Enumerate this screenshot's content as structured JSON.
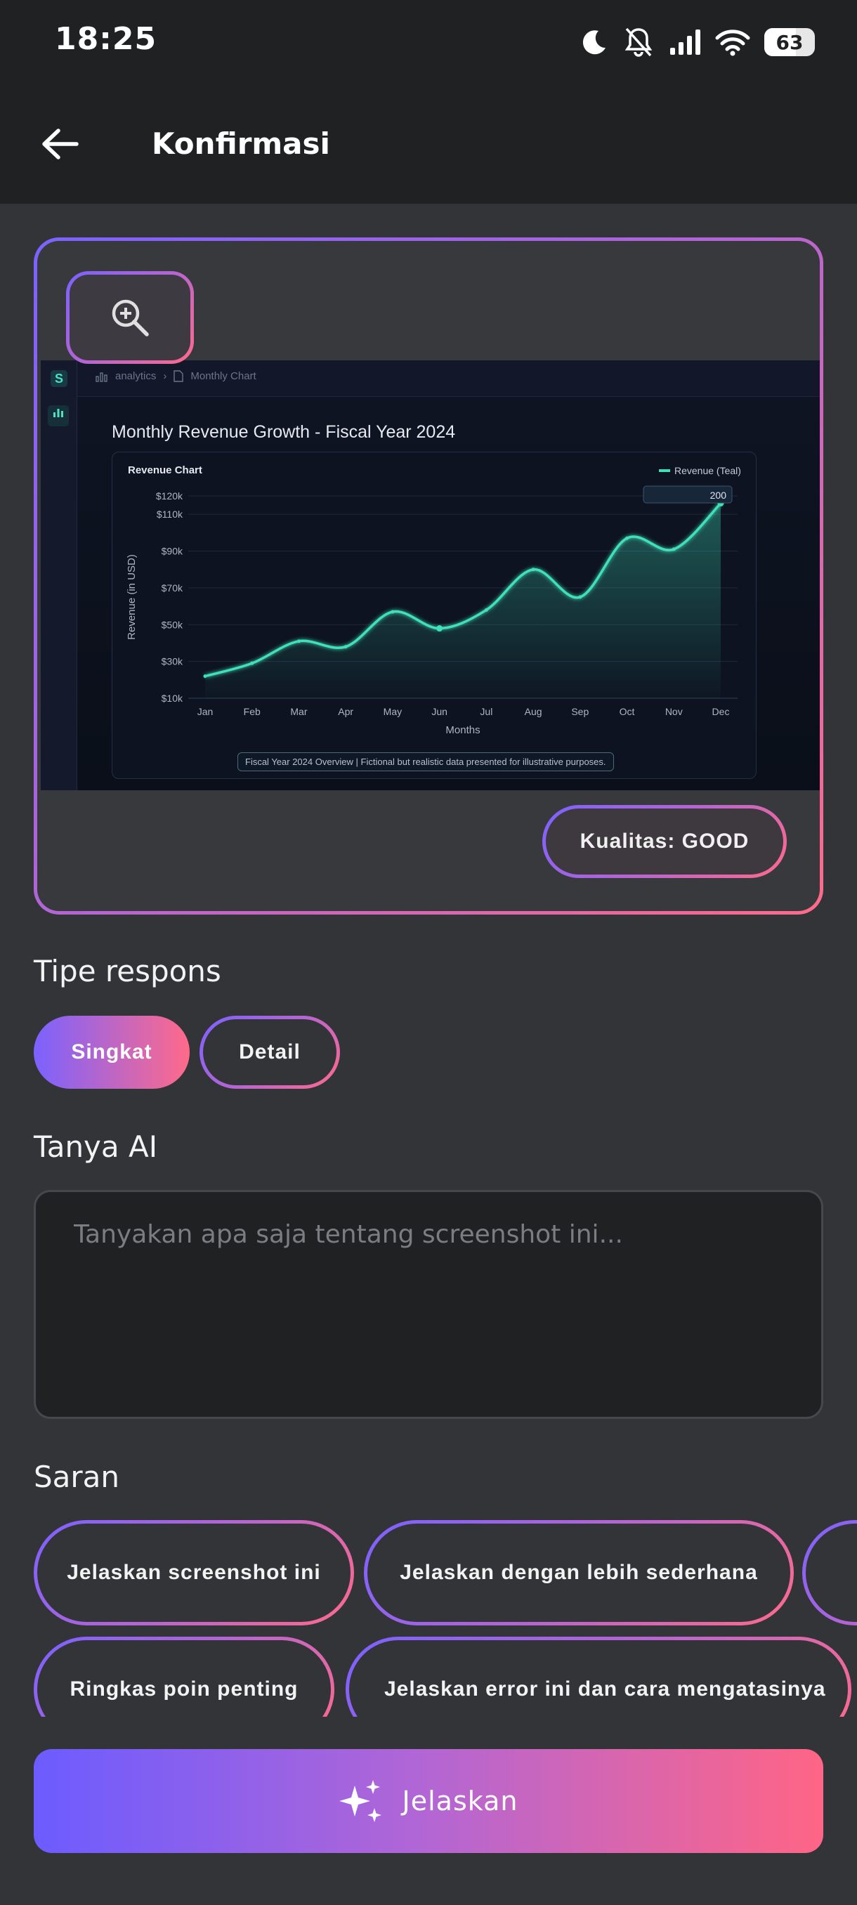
{
  "status_bar": {
    "time": "18:25",
    "battery_level": "63",
    "battery_fraction": 0.63,
    "icons": [
      "moon-icon",
      "bell-off-icon",
      "signal-icon",
      "wifi-icon",
      "battery-icon"
    ]
  },
  "app_bar": {
    "title": "Konfirmasi",
    "back_icon": "arrow-left-icon"
  },
  "preview": {
    "zoom_icon": "zoom-in-icon",
    "quality_label": "Kualitas: GOOD",
    "screenshot": {
      "breadcrumb_1": "analytics",
      "breadcrumb_sep": "›",
      "breadcrumb_2": "Monthly Chart",
      "logo_letter": "S",
      "side_icon": "bar-chart-icon",
      "footer_note": "Fiscal Year 2024 Overview | Fictional but realistic data presented for illustrative purposes."
    }
  },
  "chart_data": {
    "type": "area",
    "title": "Monthly Revenue Growth - Fiscal Year 2024",
    "panel_title": "Revenue Chart",
    "xlabel": "Months",
    "ylabel": "Revenue (in USD)",
    "x": [
      "Jan",
      "Feb",
      "Mar",
      "Apr",
      "May",
      "Jun",
      "Jul",
      "Aug",
      "Sep",
      "Oct",
      "Nov",
      "Dec"
    ],
    "y_ticks": [
      "$10k",
      "$30k",
      "$50k",
      "$70k",
      "$90k",
      "$110k",
      "$120k"
    ],
    "y_tick_values": [
      10,
      30,
      50,
      70,
      90,
      110,
      120
    ],
    "ylim": [
      10,
      120
    ],
    "series": [
      {
        "name": "Revenue (Teal)",
        "values": [
          22,
          29,
          41,
          38,
          57,
          48,
          58,
          80,
          65,
          97,
          91,
          116
        ],
        "color": "#3fe0b8"
      }
    ],
    "tooltip": "200",
    "grid": true,
    "legend_position": "top-right"
  },
  "response_type": {
    "title": "Tipe respons",
    "options": [
      "Singkat",
      "Detail"
    ],
    "selected": "Singkat"
  },
  "ask_ai": {
    "title": "Tanya AI",
    "placeholder": "Tanyakan apa saja tentang screenshot ini..."
  },
  "suggestions": {
    "title": "Saran",
    "items": [
      "Jelaskan screenshot ini",
      "Jelaskan dengan lebih sederhana",
      "Ringkas poin penting",
      "Jelaskan error ini dan cara mengatasinya"
    ]
  },
  "action": {
    "label": "Jelaskan",
    "icon": "sparkles-icon"
  },
  "colors": {
    "background": "#323437",
    "bar": "#1f2123",
    "gradient_start": "#7b62ff",
    "gradient_end": "#ff6a8a",
    "chart_line": "#3fe0b8"
  }
}
